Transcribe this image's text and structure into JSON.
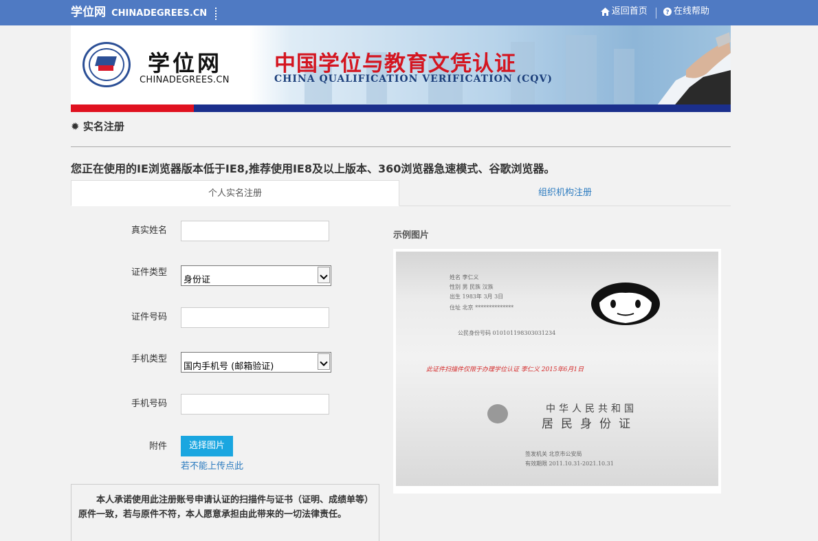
{
  "topbar": {
    "brand_cn": "学位网",
    "brand_en": "CHINADEGREES.CN",
    "home_label": "返回首页",
    "help_label": "在线帮助"
  },
  "banner": {
    "site_cn": "学位网",
    "site_en": "CHINADEGREES.CN",
    "title_cn": "中国学位与教育文凭认证",
    "title_en": "CHINA QUALIFICATION VERIFICATION (CQV)"
  },
  "page": {
    "section_title": "实名注册",
    "notice": "您正在使用的IE浏览器版本低于IE8,推荐使用IE8及以上版本、360浏览器急速模式、谷歌浏览器。"
  },
  "tabs": [
    {
      "label": "个人实名注册",
      "active": true
    },
    {
      "label": "组织机构注册",
      "active": false
    }
  ],
  "form": {
    "real_name_label": "真实姓名",
    "real_name_value": "",
    "id_type_label": "证件类型",
    "id_type_value": "身份证",
    "id_number_label": "证件号码",
    "id_number_value": "",
    "phone_type_label": "手机类型",
    "phone_type_value": "国内手机号 (邮箱验证)",
    "phone_number_label": "手机号码",
    "phone_number_value": "",
    "attachment_label": "附件",
    "upload_button": "选择图片",
    "upload_alt_link": "若不能上传点此"
  },
  "promise": "本人承诺使用此注册账号申请认证的扫描件与证书（证明、成绩单等）原件一致，若与原件不符，本人愿意承担由此带来的一切法律责任。",
  "example": {
    "label": "示例图片",
    "name_line": "姓名  李仁义",
    "gender_line": "性别  男    民族  汉族",
    "birth_line": "出生  1983年  3月  3日",
    "addr_line": "住址  北京 **************",
    "id_line": "公民身份号码  010101198303031234",
    "red_note": "此证件扫描件仅限于办理学位认证  李仁义  2015年6月1日",
    "country": "中华人民共和国",
    "card_title": "居民身份证",
    "authority_line": "签发机关   北京市公安局",
    "valid_line": "有效期限   2011.10.31-2021.10.31"
  }
}
